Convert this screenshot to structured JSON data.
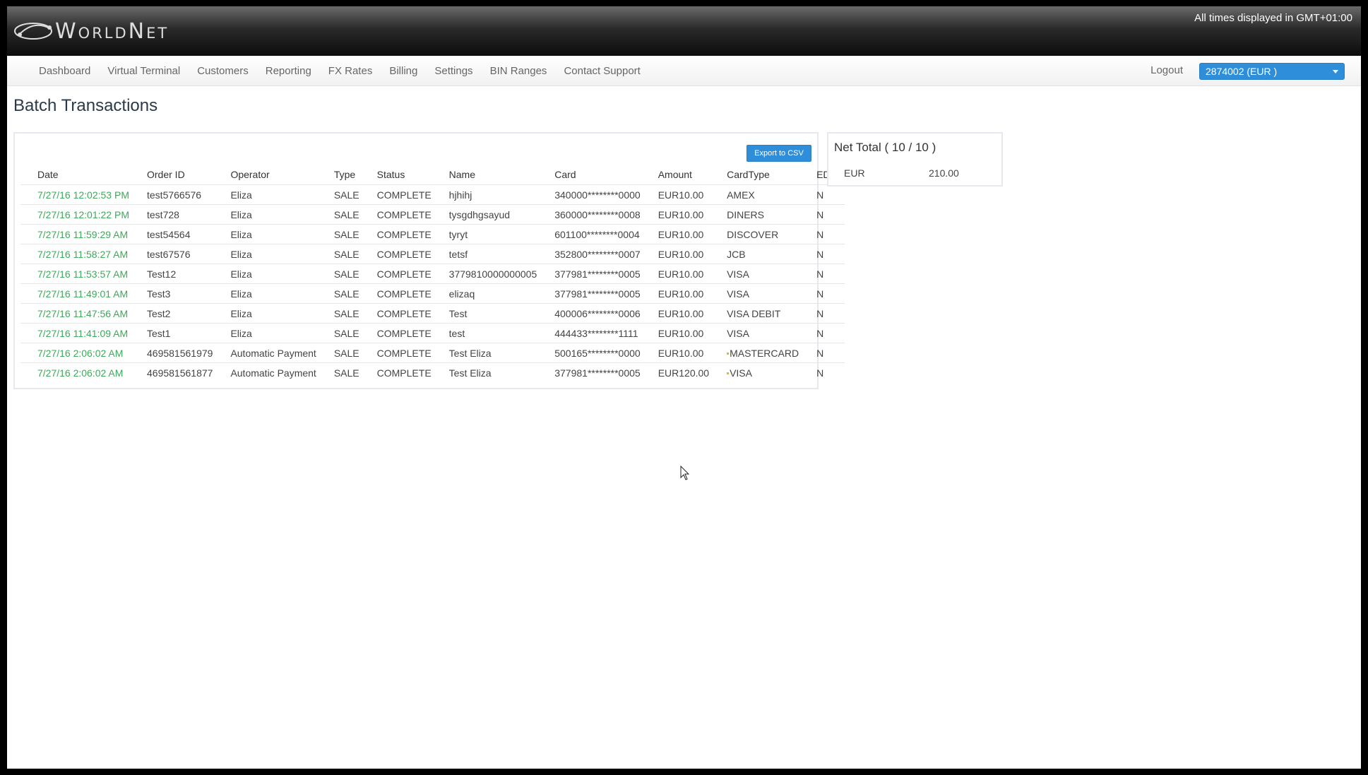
{
  "header": {
    "brand": "WorldNet",
    "timezone_note": "All times displayed in GMT+01:00"
  },
  "nav": {
    "items": [
      "Dashboard",
      "Virtual Terminal",
      "Customers",
      "Reporting",
      "FX Rates",
      "Billing",
      "Settings",
      "BIN Ranges",
      "Contact Support"
    ],
    "logout": "Logout",
    "merchant_select": "2874002 (EUR )"
  },
  "page": {
    "title": "Batch Transactions",
    "export_label": "Export to CSV"
  },
  "table": {
    "columns": [
      "Date",
      "Order ID",
      "Operator",
      "Type",
      "Status",
      "Name",
      "Card",
      "Amount",
      "CardType",
      "EDCC"
    ],
    "rows": [
      [
        "7/27/16 12:02:53 PM",
        "test5766576",
        "Eliza",
        "SALE",
        "COMPLETE",
        "hjhihj",
        "340000********0000",
        "EUR10.00",
        "AMEX",
        "N"
      ],
      [
        "7/27/16 12:01:22 PM",
        "test728",
        "Eliza",
        "SALE",
        "COMPLETE",
        "tysgdhgsayud",
        "360000********0008",
        "EUR10.00",
        "DINERS",
        "N"
      ],
      [
        "7/27/16 11:59:29 AM",
        "test54564",
        "Eliza",
        "SALE",
        "COMPLETE",
        "tyryt",
        "601100********0004",
        "EUR10.00",
        "DISCOVER",
        "N"
      ],
      [
        "7/27/16 11:58:27 AM",
        "test67576",
        "Eliza",
        "SALE",
        "COMPLETE",
        "tetsf",
        "352800********0007",
        "EUR10.00",
        "JCB",
        "N"
      ],
      [
        "7/27/16 11:53:57 AM",
        "Test12",
        "Eliza",
        "SALE",
        "COMPLETE",
        "3779810000000005",
        "377981********0005",
        "EUR10.00",
        "VISA",
        "N"
      ],
      [
        "7/27/16 11:49:01 AM",
        "Test3",
        "Eliza",
        "SALE",
        "COMPLETE",
        "elizaq",
        "377981********0005",
        "EUR10.00",
        "VISA",
        "N"
      ],
      [
        "7/27/16 11:47:56 AM",
        "Test2",
        "Eliza",
        "SALE",
        "COMPLETE",
        "Test",
        "400006********0006",
        "EUR10.00",
        "VISA DEBIT",
        "N"
      ],
      [
        "7/27/16 11:41:09 AM",
        "Test1",
        "Eliza",
        "SALE",
        "COMPLETE",
        "test",
        "444433********1111",
        "EUR10.00",
        "VISA",
        "N"
      ],
      [
        "7/27/16 2:06:02 AM",
        "469581561979",
        "Automatic Payment",
        "SALE",
        "COMPLETE",
        "Test Eliza",
        "500165********0000",
        "EUR10.00",
        "MASTERCARD",
        "N"
      ],
      [
        "7/27/16 2:06:02 AM",
        "469581561877",
        "Automatic Payment",
        "SALE",
        "COMPLETE",
        "Test Eliza",
        "377981********0005",
        "EUR120.00",
        "VISA",
        "N"
      ]
    ],
    "flagged_rows": [
      8,
      9
    ]
  },
  "totals": {
    "title": "Net Total ( 10 / 10 )",
    "currency": "EUR",
    "amount": "210.00"
  },
  "colors": {
    "accent": "#2f8ed9",
    "date_link": "#3caa5a"
  }
}
